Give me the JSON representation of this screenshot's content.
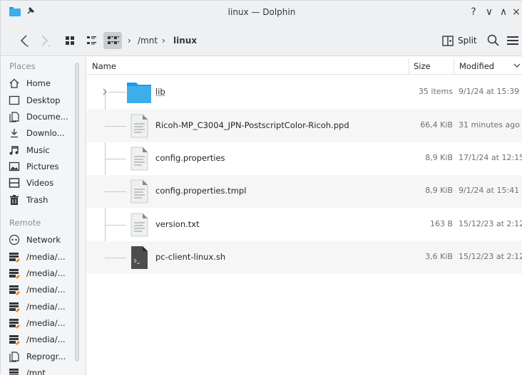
{
  "window": {
    "title": "linux — Dolphin",
    "buttons": {
      "help": "?",
      "minimize": "∨",
      "maximize": "∧",
      "close": "×"
    }
  },
  "toolbar": {
    "breadcrumb": [
      "/mnt",
      "linux"
    ],
    "split_label": "Split",
    "active_view": "compact"
  },
  "sidebar": {
    "places_title": "Places",
    "places": [
      {
        "icon": "home-icon",
        "label": "Home"
      },
      {
        "icon": "desktop-icon",
        "label": "Desktop"
      },
      {
        "icon": "documents-icon",
        "label": "Docume..."
      },
      {
        "icon": "downloads-icon",
        "label": "Downlo..."
      },
      {
        "icon": "music-icon",
        "label": "Music"
      },
      {
        "icon": "pictures-icon",
        "label": "Pictures"
      },
      {
        "icon": "videos-icon",
        "label": "Videos"
      },
      {
        "icon": "trash-icon",
        "label": "Trash"
      }
    ],
    "remote_title": "Remote",
    "remote": [
      {
        "icon": "network-icon",
        "label": "Network"
      },
      {
        "icon": "drive-icon",
        "label": "/media/..."
      },
      {
        "icon": "drive-icon",
        "label": "/media/..."
      },
      {
        "icon": "drive-icon",
        "label": "/media/..."
      },
      {
        "icon": "drive-icon",
        "label": "/media/..."
      },
      {
        "icon": "drive-icon",
        "label": "/media/..."
      },
      {
        "icon": "drive-icon",
        "label": "/media/..."
      },
      {
        "icon": "document-icon",
        "label": "Reprogr..."
      },
      {
        "icon": "drive-icon",
        "label": "/mnt"
      }
    ]
  },
  "columns": {
    "name": "Name",
    "size": "Size",
    "modified": "Modified"
  },
  "files": [
    {
      "name": "lib",
      "type": "folder",
      "size": "35 items",
      "modified": "9/1/24 at 15:39"
    },
    {
      "name": "Ricoh-MP_C3004_JPN-PostscriptColor-Ricoh.ppd",
      "type": "text",
      "size": "66,4 KiB",
      "modified": "31 minutes ago"
    },
    {
      "name": "config.properties",
      "type": "text",
      "size": "8,9 KiB",
      "modified": "17/1/24 at 12:15"
    },
    {
      "name": "config.properties.tmpl",
      "type": "text",
      "size": "8,9 KiB",
      "modified": "9/1/24 at 15:41"
    },
    {
      "name": "version.txt",
      "type": "text",
      "size": "163 B",
      "modified": "15/12/23 at 2:12"
    },
    {
      "name": "pc-client-linux.sh",
      "type": "script",
      "size": "3,6 KiB",
      "modified": "15/12/23 at 2:12"
    }
  ],
  "colors": {
    "accent": "#3daee9",
    "folder": "#1d99f3",
    "chrome": "#eff0f1"
  }
}
